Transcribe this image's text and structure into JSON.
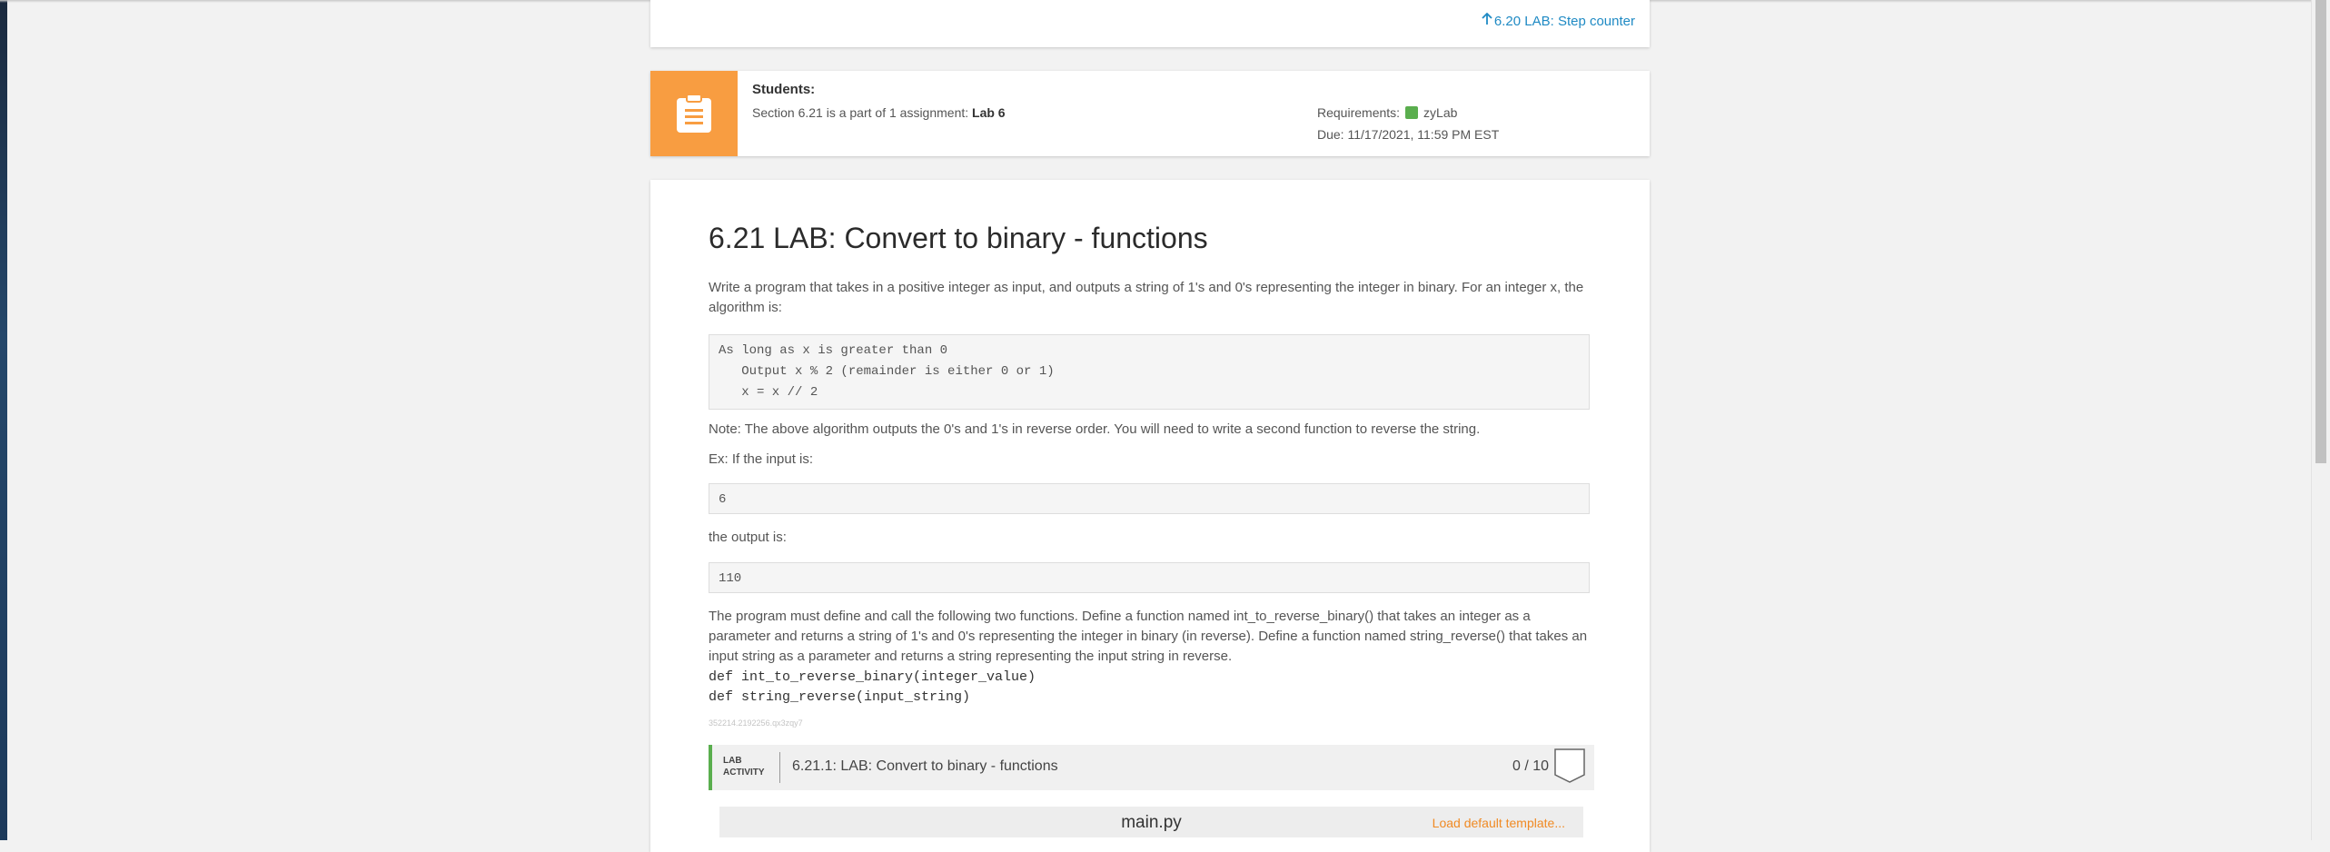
{
  "nav": {
    "next_link": "6.20 LAB: Step counter"
  },
  "assignment": {
    "students_title": "Students:",
    "section_text": "Section 6.21 is a part of 1 assignment: ",
    "assignment_name": "Lab 6",
    "requirements_label": "Requirements:",
    "requirements_value": "zyLab",
    "due": "Due: 11/17/2021, 11:59 PM EST"
  },
  "main": {
    "title": "6.21 LAB: Convert to binary - functions",
    "intro": "Write a program that takes in a positive integer as input, and outputs a string of 1's and 0's representing the integer in binary. For an integer x, the algorithm is:",
    "algorithm": "As long as x is greater than 0\n   Output x % 2 (remainder is either 0 or 1)\n   x = x // 2",
    "note": "Note: The above algorithm outputs the 0's and 1's in reverse order. You will need to write a second function to reverse the string.",
    "ex_label": "Ex: If the input is:",
    "ex_input": "6",
    "output_label": "the output is:",
    "ex_output": "110",
    "functions_text": "The program must define and call the following two functions. Define a function named int_to_reverse_binary() that takes an integer as a parameter and returns a string of 1's and 0's representing the integer in binary (in reverse). Define a function named string_reverse() that takes an input string as a parameter and returns a string representing the input string in reverse.",
    "sig1": "def int_to_reverse_binary(integer_value)",
    "sig2": "def string_reverse(input_string)",
    "small_id": "352214.2192256.qx3zqy7"
  },
  "lab_activity": {
    "label_line1": "LAB",
    "label_line2": "ACTIVITY",
    "title": "6.21.1: LAB: Convert to binary - functions",
    "score": "0 / 10"
  },
  "editor": {
    "filename": "main.py",
    "load_template": "Load default template..."
  },
  "colors": {
    "accent_orange": "#f89d41",
    "link_blue": "#1f8ac4",
    "lab_green": "#5aae4e"
  }
}
